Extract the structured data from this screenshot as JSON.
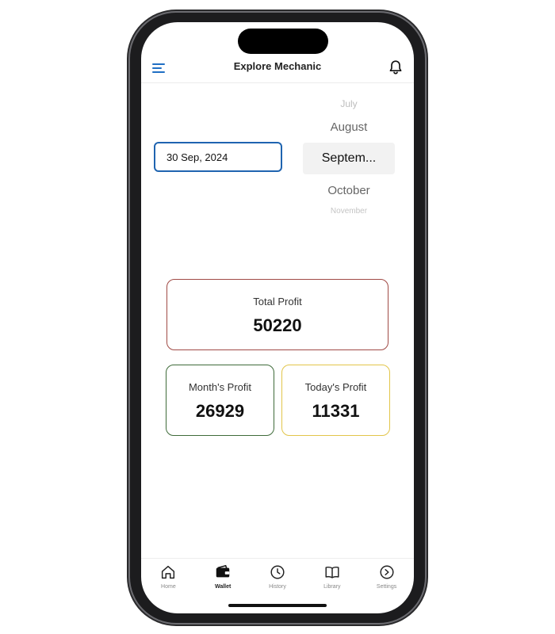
{
  "app_bar": {
    "title": "Explore Mechanic",
    "menu_icon": "menu-icon",
    "notification_icon": "bell-icon",
    "accent_color": "#1f6fc4"
  },
  "date_field": {
    "value": "30 Sep, 2024",
    "border_color": "#1f64b0"
  },
  "month_picker": {
    "items": [
      "July",
      "August",
      "Septem...",
      "October",
      "November"
    ],
    "selected": "Septem..."
  },
  "cards": {
    "total": {
      "label": "Total Profit",
      "value": "50220",
      "border_color": "#a04a45"
    },
    "month": {
      "label": "Month's Profit",
      "value": "26929",
      "border_color": "#3f6b3a"
    },
    "today": {
      "label": "Today's Profit",
      "value": "11331",
      "border_color": "#e2c54a"
    }
  },
  "bottom_nav": {
    "items": [
      {
        "label": "Home",
        "icon": "home-icon"
      },
      {
        "label": "Wallet",
        "icon": "wallet-icon"
      },
      {
        "label": "History",
        "icon": "clock-icon"
      },
      {
        "label": "Library",
        "icon": "book-icon"
      },
      {
        "label": "Settings",
        "icon": "arrow-circle-icon"
      }
    ],
    "active": "Wallet"
  }
}
